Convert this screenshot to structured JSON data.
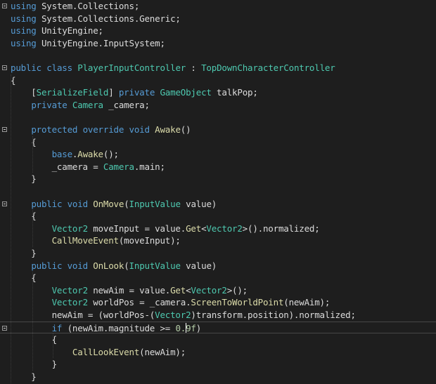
{
  "editor": {
    "lines": [
      {
        "segments": [
          {
            "t": "using",
            "c": "kw"
          },
          {
            "t": " System.Collections;",
            "c": "pl"
          }
        ]
      },
      {
        "segments": [
          {
            "t": "using",
            "c": "kw"
          },
          {
            "t": " System.Collections.Generic;",
            "c": "pl"
          }
        ]
      },
      {
        "segments": [
          {
            "t": "using",
            "c": "kw"
          },
          {
            "t": " UnityEngine;",
            "c": "pl"
          }
        ]
      },
      {
        "segments": [
          {
            "t": "using",
            "c": "kw"
          },
          {
            "t": " UnityEngine.InputSystem;",
            "c": "pl"
          }
        ]
      },
      {
        "segments": [
          {
            "t": "",
            "c": "pl"
          }
        ]
      },
      {
        "segments": [
          {
            "t": "public",
            "c": "kw"
          },
          {
            "t": " ",
            "c": "pl"
          },
          {
            "t": "class",
            "c": "kw"
          },
          {
            "t": " ",
            "c": "pl"
          },
          {
            "t": "PlayerInputController",
            "c": "ty"
          },
          {
            "t": " : ",
            "c": "pl"
          },
          {
            "t": "TopDownCharacterController",
            "c": "ty"
          }
        ]
      },
      {
        "segments": [
          {
            "t": "{",
            "c": "pl"
          }
        ]
      },
      {
        "segments": [
          {
            "t": "    [",
            "c": "pl"
          },
          {
            "t": "SerializeField",
            "c": "ty"
          },
          {
            "t": "] ",
            "c": "pl"
          },
          {
            "t": "private",
            "c": "kw"
          },
          {
            "t": " ",
            "c": "pl"
          },
          {
            "t": "GameObject",
            "c": "ty"
          },
          {
            "t": " talkPop;",
            "c": "pl"
          }
        ]
      },
      {
        "segments": [
          {
            "t": "    ",
            "c": "pl"
          },
          {
            "t": "private",
            "c": "kw"
          },
          {
            "t": " ",
            "c": "pl"
          },
          {
            "t": "Camera",
            "c": "ty"
          },
          {
            "t": " _camera;",
            "c": "pl"
          }
        ]
      },
      {
        "segments": [
          {
            "t": "",
            "c": "pl"
          }
        ]
      },
      {
        "segments": [
          {
            "t": "    ",
            "c": "pl"
          },
          {
            "t": "protected",
            "c": "kw"
          },
          {
            "t": " ",
            "c": "pl"
          },
          {
            "t": "override",
            "c": "kw"
          },
          {
            "t": " ",
            "c": "pl"
          },
          {
            "t": "void",
            "c": "kw"
          },
          {
            "t": " ",
            "c": "pl"
          },
          {
            "t": "Awake",
            "c": "me"
          },
          {
            "t": "()",
            "c": "pl"
          }
        ]
      },
      {
        "segments": [
          {
            "t": "    {",
            "c": "pl"
          }
        ]
      },
      {
        "segments": [
          {
            "t": "        ",
            "c": "pl"
          },
          {
            "t": "base",
            "c": "kw"
          },
          {
            "t": ".",
            "c": "pl"
          },
          {
            "t": "Awake",
            "c": "me"
          },
          {
            "t": "();",
            "c": "pl"
          }
        ]
      },
      {
        "segments": [
          {
            "t": "        _camera = ",
            "c": "pl"
          },
          {
            "t": "Camera",
            "c": "ty"
          },
          {
            "t": ".main;",
            "c": "pl"
          }
        ]
      },
      {
        "segments": [
          {
            "t": "    }",
            "c": "pl"
          }
        ]
      },
      {
        "segments": [
          {
            "t": "",
            "c": "pl"
          }
        ]
      },
      {
        "segments": [
          {
            "t": "    ",
            "c": "pl"
          },
          {
            "t": "public",
            "c": "kw"
          },
          {
            "t": " ",
            "c": "pl"
          },
          {
            "t": "void",
            "c": "kw"
          },
          {
            "t": " ",
            "c": "pl"
          },
          {
            "t": "OnMove",
            "c": "me"
          },
          {
            "t": "(",
            "c": "pl"
          },
          {
            "t": "InputValue",
            "c": "ty"
          },
          {
            "t": " value)",
            "c": "pl"
          }
        ]
      },
      {
        "segments": [
          {
            "t": "    {",
            "c": "pl"
          }
        ]
      },
      {
        "segments": [
          {
            "t": "        ",
            "c": "pl"
          },
          {
            "t": "Vector2",
            "c": "ty"
          },
          {
            "t": " moveInput = value.",
            "c": "pl"
          },
          {
            "t": "Get",
            "c": "me"
          },
          {
            "t": "<",
            "c": "pl"
          },
          {
            "t": "Vector2",
            "c": "ty"
          },
          {
            "t": ">().normalized;",
            "c": "pl"
          }
        ]
      },
      {
        "segments": [
          {
            "t": "        ",
            "c": "pl"
          },
          {
            "t": "CallMoveEvent",
            "c": "me"
          },
          {
            "t": "(moveInput);",
            "c": "pl"
          }
        ]
      },
      {
        "segments": [
          {
            "t": "    }",
            "c": "pl"
          }
        ]
      },
      {
        "segments": [
          {
            "t": "    ",
            "c": "pl"
          },
          {
            "t": "public",
            "c": "kw"
          },
          {
            "t": " ",
            "c": "pl"
          },
          {
            "t": "void",
            "c": "kw"
          },
          {
            "t": " ",
            "c": "pl"
          },
          {
            "t": "OnLook",
            "c": "me"
          },
          {
            "t": "(",
            "c": "pl"
          },
          {
            "t": "InputValue",
            "c": "ty"
          },
          {
            "t": " value)",
            "c": "pl"
          }
        ]
      },
      {
        "segments": [
          {
            "t": "    {",
            "c": "pl"
          }
        ]
      },
      {
        "segments": [
          {
            "t": "        ",
            "c": "pl"
          },
          {
            "t": "Vector2",
            "c": "ty"
          },
          {
            "t": " newAim = value.",
            "c": "pl"
          },
          {
            "t": "Get",
            "c": "me"
          },
          {
            "t": "<",
            "c": "pl"
          },
          {
            "t": "Vector2",
            "c": "ty"
          },
          {
            "t": ">();",
            "c": "pl"
          }
        ]
      },
      {
        "segments": [
          {
            "t": "        ",
            "c": "pl"
          },
          {
            "t": "Vector2",
            "c": "ty"
          },
          {
            "t": " worldPos = _camera.",
            "c": "pl"
          },
          {
            "t": "ScreenToWorldPoint",
            "c": "me"
          },
          {
            "t": "(newAim);",
            "c": "pl"
          }
        ]
      },
      {
        "segments": [
          {
            "t": "        newAim = (worldPos-(",
            "c": "pl"
          },
          {
            "t": "Vector2",
            "c": "ty"
          },
          {
            "t": ")transform.position).normalized;",
            "c": "pl"
          }
        ]
      },
      {
        "segments": [
          {
            "t": "        ",
            "c": "pl"
          },
          {
            "t": "if",
            "c": "kw"
          },
          {
            "t": " (newAim.magnitude >= ",
            "c": "pl"
          },
          {
            "t": "0.9f",
            "c": "nu"
          },
          {
            "t": ")",
            "c": "pl"
          }
        ]
      },
      {
        "segments": [
          {
            "t": "        {",
            "c": "pl"
          }
        ]
      },
      {
        "segments": [
          {
            "t": "            ",
            "c": "pl"
          },
          {
            "t": "CallLookEvent",
            "c": "me"
          },
          {
            "t": "(newAim);",
            "c": "pl"
          }
        ]
      },
      {
        "segments": [
          {
            "t": "        }",
            "c": "pl"
          }
        ]
      },
      {
        "segments": [
          {
            "t": "    }",
            "c": "pl"
          }
        ]
      }
    ]
  },
  "colors": {
    "background": "#1e1e1e",
    "keyword": "#569cd6",
    "type": "#4ec9b0",
    "method": "#dcdcaa",
    "plain": "#dcdcdc",
    "number": "#b5cea8"
  }
}
